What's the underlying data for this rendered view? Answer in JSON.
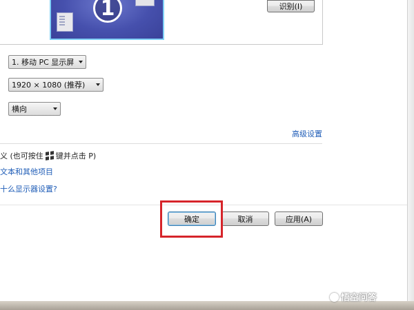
{
  "preview": {
    "monitor_number": "1",
    "identify_button": "识别(I)"
  },
  "display_select": {
    "value": "1. 移动 PC 显示屏"
  },
  "resolution_select": {
    "value": "1920 × 1080 (推荐)"
  },
  "orientation_select": {
    "value": "横向"
  },
  "advanced_link": "高级设置",
  "hint": {
    "before": "义 (也可按住",
    "after": "键并点击 P)"
  },
  "links": {
    "text_size": "文本和其他项目",
    "which_settings": "十么显示器设置?"
  },
  "buttons": {
    "ok": "确定",
    "cancel": "取消",
    "apply": "应用(A)"
  },
  "watermark": {
    "text": "悟空问答"
  }
}
